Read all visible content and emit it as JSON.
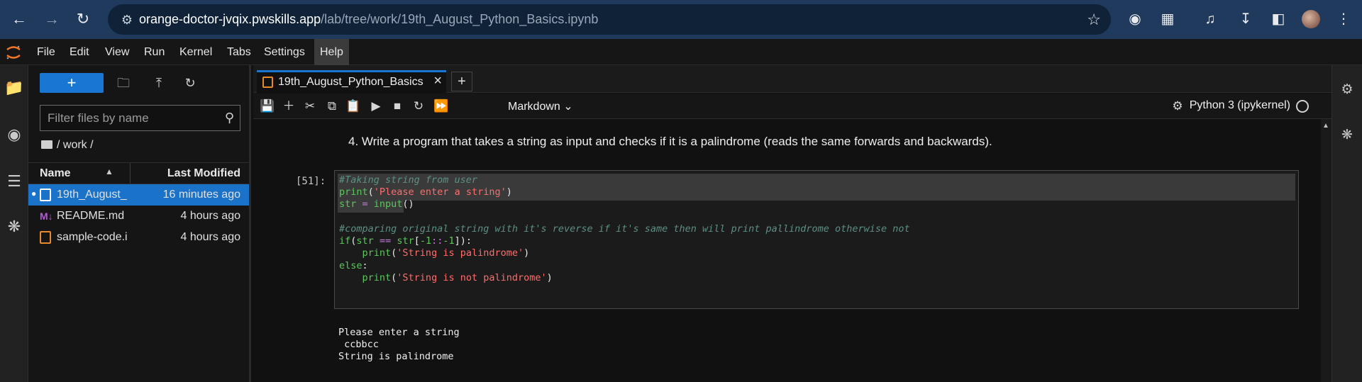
{
  "browser": {
    "url_host": "orange-doctor-jvqix.pwskills.app",
    "url_path": "/lab/tree/work/19th_August_Python_Basics.ipynb"
  },
  "menu": [
    "File",
    "Edit",
    "View",
    "Run",
    "Kernel",
    "Tabs",
    "Settings",
    "Help"
  ],
  "file_browser": {
    "new_label": "+",
    "filter_placeholder": "Filter files by name",
    "breadcrumb": "/ work /",
    "col_name": "Name",
    "col_modified": "Last Modified",
    "files": [
      {
        "name": "19th_August_Python_Basics.ipynb",
        "modified": "16 minutes ago",
        "type": "notebook"
      },
      {
        "name": "README.md",
        "modified": "4 hours ago",
        "type": "markdown"
      },
      {
        "name": "sample-code.ipynb",
        "modified": "4 hours ago",
        "type": "notebook"
      }
    ]
  },
  "tab": {
    "title": "19th_August_Python_Basics.ipynb",
    "add_label": "+"
  },
  "toolbar": {
    "cell_type": "Markdown",
    "kernel": "Python 3 (ipykernel)"
  },
  "notebook": {
    "markdown": "4. Write a program that takes a string as input and checks if it is a palindrome (reads the same forwards and backwards).",
    "prompt": "[51]:",
    "code": {
      "comment1": "#Taking string from user",
      "print_fn": "print",
      "prompt_str": "'Please enter a string'",
      "var": "str",
      "assign": " = ",
      "input_fn": "input",
      "comment2": "#comparing original string with it's reverse if it's same then will print pallindrome otherwise not",
      "if_kw": "if",
      "eq": "==",
      "slice_a": "-1",
      "slice_b": "::",
      "slice_c": "-1",
      "str_pal": "'String is palindrome'",
      "else_kw": "else",
      "str_notpal": "'String is not palindrome'"
    },
    "output": {
      "line1": "Please enter a string",
      "line2": " ccbbcc",
      "line3": "String is palindrome"
    }
  },
  "colors": {
    "accent": "#1976d2",
    "notebook_icon": "#e88a2b",
    "markdown_icon": "#b35bd6"
  }
}
